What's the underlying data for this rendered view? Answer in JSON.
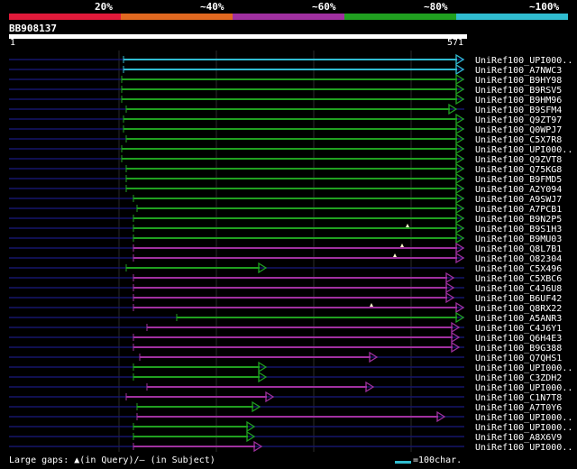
{
  "legend": {
    "segments": [
      {
        "label": "20%",
        "color": "#e01a3a"
      },
      {
        "label": "~40%",
        "color": "#e06820"
      },
      {
        "label": "~60%",
        "color": "#a030a0"
      },
      {
        "label": "~80%",
        "color": "#20a020"
      },
      {
        "label": "~100%",
        "color": "#30bcd0"
      }
    ]
  },
  "query": {
    "name": "BB908137",
    "start": "1",
    "end": "571"
  },
  "hits": [
    {
      "name": "UniRef100_UPI000..",
      "start": 137,
      "end": 514,
      "color": "#30bcd0"
    },
    {
      "name": "UniRef100_A7NWC3",
      "start": 137,
      "end": 514,
      "color": "#30bcd0"
    },
    {
      "name": "UniRef100_B9HY98",
      "start": 135,
      "end": 514,
      "color": "#20a020"
    },
    {
      "name": "UniRef100_B9RSV5",
      "start": 135,
      "end": 514,
      "color": "#20a020"
    },
    {
      "name": "UniRef100_B9HM96",
      "start": 135,
      "end": 514,
      "color": "#20a020"
    },
    {
      "name": "UniRef100_B9SFM4",
      "start": 140,
      "end": 506,
      "color": "#20a020"
    },
    {
      "name": "UniRef100_Q9ZT97",
      "start": 137,
      "end": 514,
      "color": "#20a020"
    },
    {
      "name": "UniRef100_Q0WPJ7",
      "start": 137,
      "end": 514,
      "color": "#20a020"
    },
    {
      "name": "UniRef100_C5X7R8",
      "start": 140,
      "end": 514,
      "color": "#20a020"
    },
    {
      "name": "UniRef100_UPI000..",
      "start": 135,
      "end": 514,
      "color": "#20a020"
    },
    {
      "name": "UniRef100_Q9ZVT8",
      "start": 135,
      "end": 514,
      "color": "#20a020"
    },
    {
      "name": "UniRef100_Q75KG8",
      "start": 140,
      "end": 514,
      "color": "#20a020"
    },
    {
      "name": "UniRef100_B9FMD5",
      "start": 140,
      "end": 514,
      "color": "#20a020"
    },
    {
      "name": "UniRef100_A2Y094",
      "start": 140,
      "end": 514,
      "color": "#20a020"
    },
    {
      "name": "UniRef100_A9SWJ7",
      "start": 148,
      "end": 514,
      "color": "#20a020"
    },
    {
      "name": "UniRef100_A7PCB1",
      "start": 152,
      "end": 514,
      "color": "#20a020"
    },
    {
      "name": "UniRef100_B9N2P5",
      "start": 148,
      "end": 514,
      "color": "#20a020"
    },
    {
      "name": "UniRef100_B9S1H3",
      "start": 148,
      "end": 514,
      "color": "#20a020"
    },
    {
      "name": "UniRef100_B9MU03",
      "start": 148,
      "end": 514,
      "color": "#20a020"
    },
    {
      "name": "UniRef100_Q8L7B1",
      "start": 148,
      "end": 514,
      "color": "#a030a0"
    },
    {
      "name": "UniRef100_O82304",
      "start": 148,
      "end": 514,
      "color": "#a030a0"
    },
    {
      "name": "UniRef100_C5X496",
      "start": 140,
      "end": 295,
      "color": "#20a020"
    },
    {
      "name": "UniRef100_C5XBC6",
      "start": 148,
      "end": 503,
      "color": "#a030a0"
    },
    {
      "name": "UniRef100_C4J6U8",
      "start": 148,
      "end": 503,
      "color": "#a030a0"
    },
    {
      "name": "UniRef100_B6UF42",
      "start": 148,
      "end": 503,
      "color": "#a030a0"
    },
    {
      "name": "UniRef100_Q8RX22",
      "start": 148,
      "end": 514,
      "color": "#a030a0"
    },
    {
      "name": "UniRef100_A5ANR3",
      "start": 196,
      "end": 514,
      "color": "#20a020"
    },
    {
      "name": "UniRef100_C4J6Y1",
      "start": 163,
      "end": 509,
      "color": "#a030a0"
    },
    {
      "name": "UniRef100_Q6H4E3",
      "start": 148,
      "end": 509,
      "color": "#a030a0"
    },
    {
      "name": "UniRef100_B9G388",
      "start": 148,
      "end": 509,
      "color": "#a030a0"
    },
    {
      "name": "UniRef100_Q7QHS1",
      "start": 155,
      "end": 418,
      "color": "#a030a0"
    },
    {
      "name": "UniRef100_UPI000..",
      "start": 148,
      "end": 295,
      "color": "#20a020"
    },
    {
      "name": "UniRef100_C3ZDH2",
      "start": 148,
      "end": 295,
      "color": "#20a020"
    },
    {
      "name": "UniRef100_UPI000..",
      "start": 163,
      "end": 414,
      "color": "#a030a0"
    },
    {
      "name": "UniRef100_C1N7T8",
      "start": 140,
      "end": 303,
      "color": "#a030a0"
    },
    {
      "name": "UniRef100_A7T0Y6",
      "start": 152,
      "end": 288,
      "color": "#20a020"
    },
    {
      "name": "UniRef100_UPI000..",
      "start": 152,
      "end": 493,
      "color": "#a030a0"
    },
    {
      "name": "UniRef100_UPI000..",
      "start": 148,
      "end": 282,
      "color": "#20a020"
    },
    {
      "name": "UniRef100_A8X6V9",
      "start": 148,
      "end": 282,
      "color": "#20a020"
    },
    {
      "name": "UniRef100_UPI000..",
      "start": 148,
      "end": 290,
      "color": "#a030a0"
    }
  ],
  "gap_markers": [
    17,
    19,
    20,
    25
  ],
  "footer": {
    "text_before": "Large gaps:",
    "text_after": "(in Query)/– (in Subject)"
  },
  "scale": {
    "label": "=100char."
  }
}
